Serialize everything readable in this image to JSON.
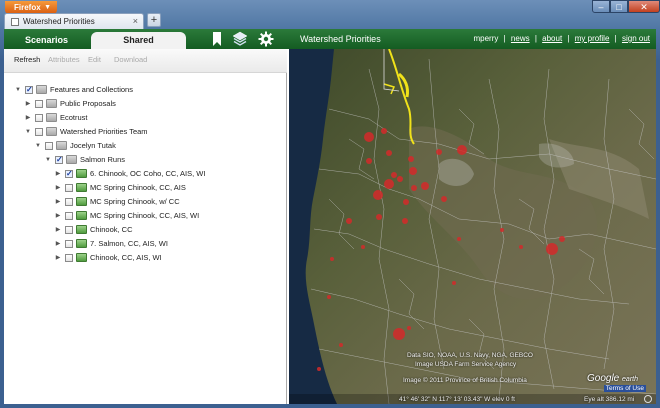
{
  "browser": {
    "menu_label": "Firefox",
    "menu_caret": "▼",
    "tab_title": "Watershed Priorities",
    "tab_close": "×",
    "new_tab": "+",
    "window_controls": {
      "minimize": "–",
      "maximize": "□",
      "close": "✕"
    }
  },
  "header": {
    "tabs": [
      {
        "label": "Scenarios"
      },
      {
        "label": "Shared"
      }
    ],
    "icons": [
      "bookmark-icon",
      "layers-icon",
      "gear-icon"
    ],
    "app_title": "Watershed Priorities",
    "username": "mperry",
    "links": [
      "news",
      "about",
      "my profile",
      "sign out"
    ],
    "separator": "|"
  },
  "toolbar": {
    "refresh": "Refresh",
    "attributes": "Attributes",
    "edit": "Edit",
    "download": "Download"
  },
  "tree": [
    {
      "label": "Features and Collections",
      "level": 0,
      "expanded": true,
      "checked": true,
      "icon": "folder"
    },
    {
      "label": "Public Proposals",
      "level": 1,
      "expanded": false,
      "checked": false,
      "icon": "folder"
    },
    {
      "label": "Ecotrust",
      "level": 1,
      "expanded": false,
      "checked": false,
      "icon": "folder"
    },
    {
      "label": "Watershed Priorities Team",
      "level": 1,
      "expanded": true,
      "checked": false,
      "icon": "folder"
    },
    {
      "label": "Jocelyn Tutak",
      "level": 2,
      "expanded": true,
      "checked": false,
      "icon": "folder"
    },
    {
      "label": "Salmon Runs",
      "level": 3,
      "expanded": true,
      "checked": true,
      "icon": "folder"
    },
    {
      "label": "6. Chinook, OC Coho, CC, AIS, WI",
      "level": 4,
      "expanded": false,
      "checked": true,
      "icon": "fish"
    },
    {
      "label": "MC Spring Chinook, CC, AIS",
      "level": 4,
      "expanded": false,
      "checked": false,
      "icon": "fish"
    },
    {
      "label": "MC Spring Chinook, w/ CC",
      "level": 4,
      "expanded": false,
      "checked": false,
      "icon": "fish"
    },
    {
      "label": "MC Spring Chinook, CC, AIS, WI",
      "level": 4,
      "expanded": false,
      "checked": false,
      "icon": "fish"
    },
    {
      "label": "Chinook, CC",
      "level": 4,
      "expanded": false,
      "checked": false,
      "icon": "fish"
    },
    {
      "label": "7. Salmon, CC, AIS, WI",
      "level": 4,
      "expanded": false,
      "checked": false,
      "icon": "fish"
    },
    {
      "label": "Chinook, CC, AIS, WI",
      "level": 4,
      "expanded": false,
      "checked": false,
      "icon": "fish"
    }
  ],
  "map": {
    "attribution_1": "Data SIO, NOAA, U.S. Navy, NGA, GEBCO",
    "attribution_2": "Image USDA Farm Service Agency",
    "attribution_3": "Image © 2011 Province of British Columbia",
    "coords": "41° 46' 32\" N  117° 13' 03.43\" W  elev    0 ft",
    "eye_alt": "Eye alt  386.12 mi",
    "logo": "Google",
    "logo_suffix": "earth",
    "terms": "Terms of Use",
    "colors": {
      "sites": "#d42a2a",
      "urban": "#f0e21a",
      "ocean": "#162a44"
    }
  }
}
